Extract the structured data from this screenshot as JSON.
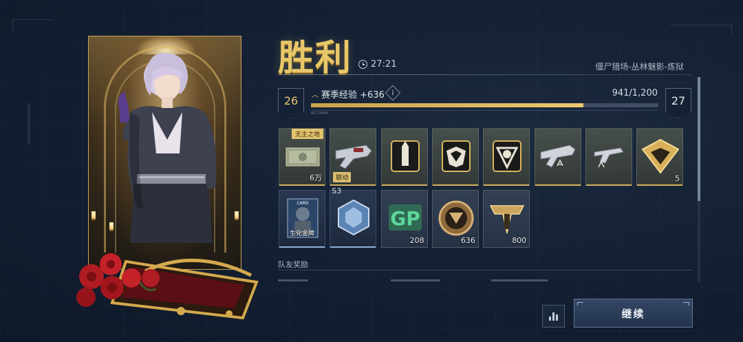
{
  "result": {
    "title": "胜利",
    "duration": "27:21",
    "map_name": "僵尸猎场-丛林魅影-炼狱"
  },
  "season_xp": {
    "current_level": "26",
    "next_level": "27",
    "label": "赛季经验 +636",
    "count": "941/1,200",
    "progress_fraction": 0.784,
    "tiny_code": "MZ-20446"
  },
  "rewards_row1": [
    {
      "icon": "cash-stack-icon",
      "tag": "无主之地",
      "qty": "6万",
      "rarity": "gold"
    },
    {
      "icon": "rifle-skin-icon",
      "tag": "联动",
      "qty": "",
      "rarity": "gold"
    },
    {
      "icon": "ammo-crate-icon",
      "qty": "",
      "rarity": "gold"
    },
    {
      "icon": "emblem-shield-icon",
      "qty": "",
      "rarity": "gold"
    },
    {
      "icon": "monster-crest-icon",
      "qty": "",
      "rarity": "gold"
    },
    {
      "icon": "weapon-blueprint-icon",
      "qty": "",
      "rarity": "gold"
    },
    {
      "icon": "pistol-blueprint-icon",
      "qty": "",
      "rarity": "gold"
    },
    {
      "icon": "gold-triangle-icon",
      "qty": "5",
      "rarity": "gold"
    }
  ],
  "rewards_row2": [
    {
      "icon": "character-card-icon",
      "caption": "生化金牌",
      "qty": "",
      "rarity": "blue"
    },
    {
      "icon": "hex-fragment-icon",
      "tag": "S3",
      "qty": "",
      "rarity": "blue"
    },
    {
      "icon": "gp-points-icon",
      "qty": "208",
      "rarity": "plain"
    },
    {
      "icon": "bronze-medal-icon",
      "qty": "636",
      "rarity": "plain"
    },
    {
      "icon": "rank-emblem-icon",
      "qty": "800",
      "rarity": "plain"
    }
  ],
  "teammate_rewards": {
    "title": "队友奖励"
  },
  "actions": {
    "continue_label": "继续"
  },
  "colors": {
    "gold": "#e8c768",
    "panel_bg": "#142034",
    "xp_fill": "#ecc86c",
    "blue_rarity": "#8eb2da"
  }
}
